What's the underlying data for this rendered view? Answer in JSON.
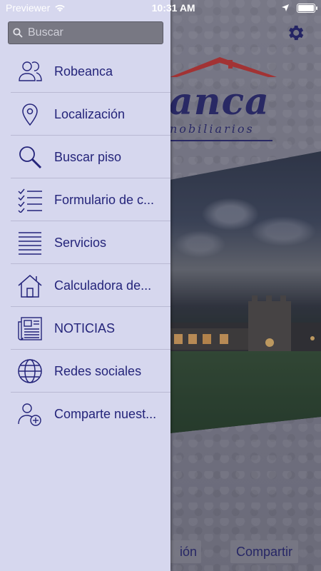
{
  "status_bar": {
    "carrier": "Previewer",
    "time": "10:31 AM"
  },
  "drawer": {
    "search": {
      "placeholder": "Buscar"
    },
    "items": [
      {
        "label": "Robeanca",
        "icon": "people-icon"
      },
      {
        "label": "Localización",
        "icon": "location-pin-icon"
      },
      {
        "label": "Buscar piso",
        "icon": "magnifier-icon"
      },
      {
        "label": "Formulario de c...",
        "icon": "checklist-icon"
      },
      {
        "label": "Servicios",
        "icon": "list-lines-icon"
      },
      {
        "label": "Calculadora de...",
        "icon": "house-icon"
      },
      {
        "label": "NOTICIAS",
        "icon": "newspaper-icon"
      },
      {
        "label": "Redes sociales",
        "icon": "globe-icon"
      },
      {
        "label": "Comparte nuest...",
        "icon": "add-user-icon"
      }
    ]
  },
  "background_app": {
    "logo_text": "anca",
    "logo_subtitle": "nobiliarios",
    "buttons": {
      "left_label": "ión",
      "right_label": "Compartir"
    }
  },
  "colors": {
    "accent": "#24247a",
    "drawer_bg": "#d6d7ee",
    "roof_red": "#c4302b"
  }
}
